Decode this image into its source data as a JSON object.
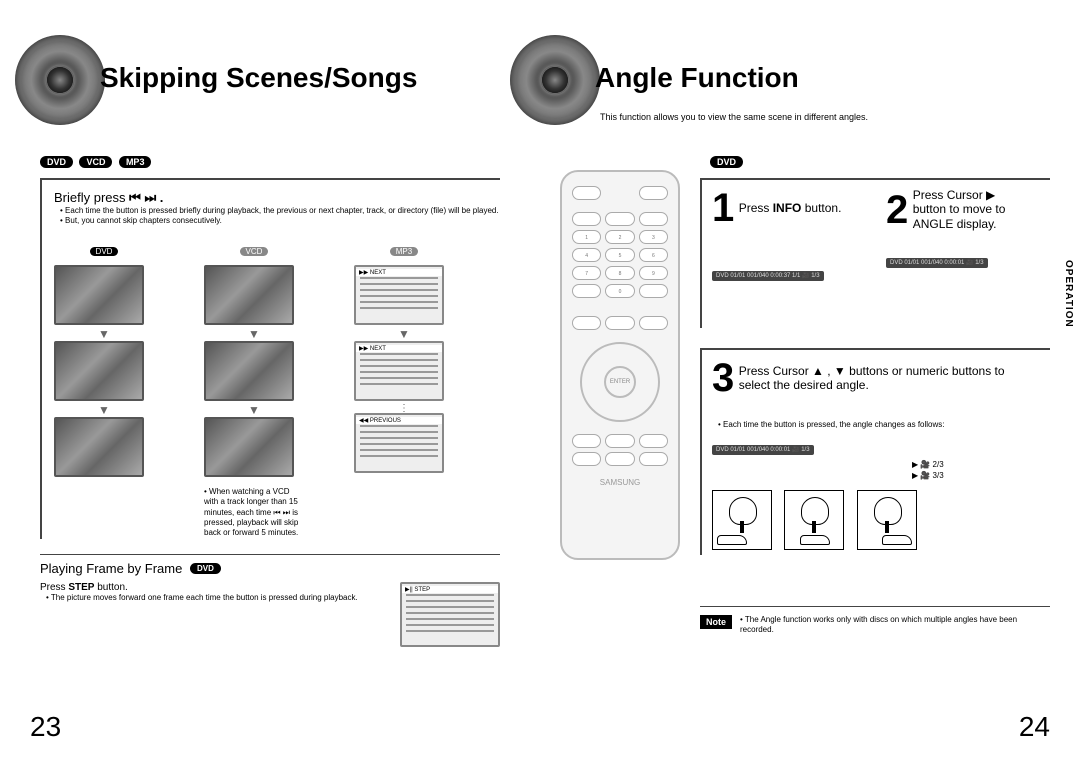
{
  "left": {
    "title": "Skipping Scenes/Songs",
    "pills": [
      "DVD",
      "VCD",
      "MP3"
    ],
    "section1": {
      "head_prefix": "Briefly press ",
      "head_symbols": "⏮ ⏭ .",
      "bullets": [
        "Each time the button is pressed briefly during playback, the previous or next chapter, track, or directory (file) will be played.",
        "But, you cannot skip chapters consecutively."
      ],
      "columns": [
        {
          "label": "DVD"
        },
        {
          "label": "VCD"
        },
        {
          "label": "MP3"
        }
      ],
      "mp3_captions": {
        "next": "▶▶ NEXT",
        "previous": "◀◀ PREVIOUS"
      },
      "vcd_note": "When watching a VCD with a track longer than 15 minutes, each time ⏮ ⏭ is pressed, playback will skip back or forward 5 minutes."
    },
    "section2": {
      "head": "Playing Frame by Frame",
      "pill": "DVD",
      "instr_prefix": "Press ",
      "instr_bold": "STEP",
      "instr_suffix": " button.",
      "bullet": "The picture moves forward one frame each time the button is pressed during playback.",
      "thumb_cap": "▶|| STEP"
    },
    "page_num": "23"
  },
  "right": {
    "title": "Angle Function",
    "subtitle": "This function allows you to view the same scene in different angles.",
    "pill": "DVD",
    "side_tab": "OPERATION",
    "step1": {
      "num": "1",
      "text_prefix": "Press ",
      "text_bold": "INFO",
      "text_suffix": " button."
    },
    "step2": {
      "num": "2",
      "text": "Press Cursor ▶ button to move to ANGLE display."
    },
    "osd1": "DVD   01/01   001/040   0:00:37   1/1   🎥 1/3",
    "osd2": "DVD   01/01   001/040   0:00:01   🎥 1/3",
    "step3": {
      "num": "3",
      "text": "Press Cursor ▲ , ▼ buttons or numeric buttons to select the desired angle."
    },
    "step3_bullet": "Each time the button is pressed, the angle changes as follows:",
    "angle_seq_head": "DVD  01/01  001/040  0:00:01  🎥 1/3",
    "angle_seq": [
      "🎥 2/3",
      "🎥 3/3"
    ],
    "note_label": "Note",
    "note_text": "The Angle function works only with discs on which multiple angles have been recorded.",
    "page_num": "24",
    "remote": {
      "brand": "SAMSUNG",
      "enter": "ENTER"
    }
  }
}
